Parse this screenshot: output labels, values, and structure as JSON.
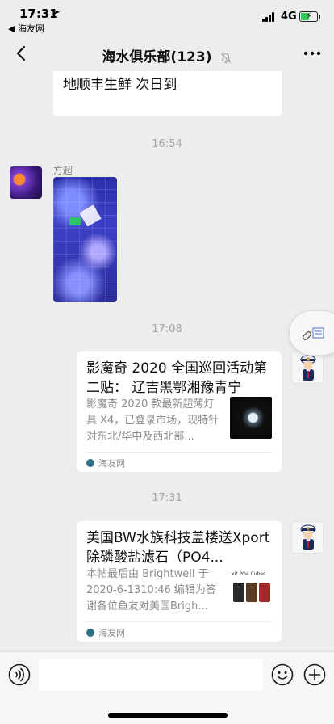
{
  "status_bar": {
    "time": "17:31",
    "back_app": "◀ 海友网",
    "network": "4G",
    "battery_percent": 55,
    "battery_color": "#34c759"
  },
  "nav": {
    "title": "海水俱乐部(123)",
    "back_icon": "chevron-left-icon",
    "mute_icon": "bell-muted-icon",
    "more_icon": "more-dots-icon"
  },
  "messages": {
    "first_text": "出软体买鱼，打包可研究价格，外地顺丰生鲜 次日到",
    "time_1": "16:54",
    "sender_1": "方超",
    "time_2": "17:08",
    "card_1": {
      "title": "影魔奇 2020 全国巡回活动第二贴：  辽吉黑鄂湘豫青宁",
      "desc": "影魔奇 2020 款最新超薄灯具 X4，已登录市场，现特针对东北/华中及西北部...",
      "source": "海友网"
    },
    "time_3": "17:31",
    "card_2": {
      "title": "美国BW水族科技盖楼送Xport除磷酸盐滤石（PO4...",
      "desc": "本帖最后由 Brightwell 于 2020-6-1310:46 编辑为答谢各位鱼友对美国Brigh...",
      "source": "海友网",
      "thumb_label": "xit PO4 Cubes"
    }
  },
  "input_bar": {
    "placeholder": ""
  }
}
